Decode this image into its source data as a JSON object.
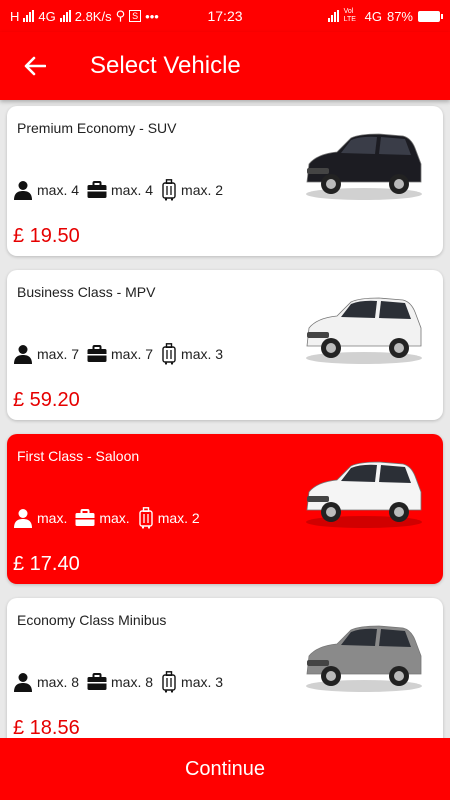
{
  "status_bar": {
    "carrier": "H",
    "network": "4G",
    "speed": "2.8K/s",
    "extra": "•••",
    "time": "17:23",
    "volte": "Vol LTE",
    "network2": "4G",
    "battery": "87%"
  },
  "header": {
    "title": "Select Vehicle",
    "back_icon": "arrow-left-icon"
  },
  "vehicles": [
    {
      "name": "Premium  Economy - SUV",
      "passengers": "max. 4",
      "suitcases": "max. 4",
      "luggage": "max. 2",
      "price": "£ 19.50",
      "selected": false,
      "car_color": "#1c1c22"
    },
    {
      "name": "Business Class - MPV",
      "passengers": "max. 7",
      "suitcases": "max. 7",
      "luggage": "max. 3",
      "price": "£ 59.20",
      "selected": false,
      "car_color": "#f2f2f2"
    },
    {
      "name": "First Class - Saloon",
      "passengers": "max.",
      "suitcases": "max.",
      "luggage": "max. 2",
      "price": "£ 17.40",
      "selected": true,
      "car_color": "#f5f5f5"
    },
    {
      "name": "Economy Class Minibus",
      "passengers": "max. 8",
      "suitcases": "max. 8",
      "luggage": "max. 3",
      "price": "£ 18.56",
      "selected": false,
      "car_color": "#8a8a8a"
    }
  ],
  "footer": {
    "continue_label": "Continue"
  },
  "colors": {
    "accent": "#ff0000",
    "price": "#e60000"
  }
}
